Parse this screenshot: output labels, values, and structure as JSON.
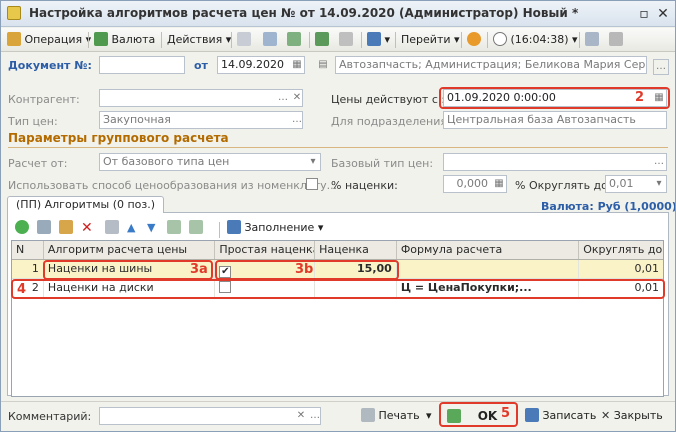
{
  "window": {
    "title": "Настройка алгоритмов расчета цен №  от 14.09.2020 (Администратор) Новый *"
  },
  "toolbar": {
    "operation": "Операция",
    "currency": "Валюта",
    "actions": "Действия",
    "goto": "Перейти",
    "time": "(16:04:38)"
  },
  "doc": {
    "number_label": "Документ №:",
    "number_value": "",
    "date_label": "от",
    "date_value": "14.09.2020",
    "org_value": "Автозапчасть; Администрация; Беликова Мария Сергеевна"
  },
  "form": {
    "counterparty_label": "Контрагент:",
    "counterparty_value": "",
    "price_type_label": "Тип цен:",
    "price_type_value": "Закупочная",
    "valid_from_label": "Цены действуют с :",
    "valid_from_value": "01.09.2020  0:00:00",
    "subdivision_label": "Для подразделения:",
    "subdivision_value": "Центральная база Автозапчасть"
  },
  "group": {
    "title": "Параметры группового расчета",
    "calc_from_label": "Расчет от:",
    "calc_from_value": "От базового типа цен",
    "base_price_label": "Базовый тип цен:",
    "base_price_value": "",
    "use_method_label": "Использовать способ ценообразования из номенклату...",
    "markup_label": "% наценки:",
    "markup_value": "0,000",
    "round_label": "% Округлять до:",
    "round_value": "0,01"
  },
  "tab": {
    "label": "(ПП) Алгоритмы (0 поз.)"
  },
  "currency_info": "Валюта: Руб (1,0000)",
  "fill_button": "Заполнение",
  "grid": {
    "headers": [
      "N",
      "Алгоритм расчета цены",
      "Простая наценка",
      "Наценка",
      "Формула расчета",
      "Округлять до"
    ],
    "rows": [
      {
        "n": "1",
        "algorithm": "Наценки на шины",
        "simple": "✔",
        "markup": "15,00",
        "formula": "",
        "round": "0,01"
      },
      {
        "n": "2",
        "algorithm": "Наценки на диски",
        "simple": "",
        "markup": "",
        "formula": "Ц = ЦенаПокупки;...",
        "round": "0,01"
      }
    ]
  },
  "bottom": {
    "comment_label": "Комментарий:",
    "comment_value": "",
    "print": "Печать",
    "ok": "OK",
    "save": "Записать",
    "close": "Закрыть"
  },
  "annotations": {
    "m2": "2",
    "m3a": "3a",
    "m3b": "3b",
    "m4": "4",
    "m5": "5"
  }
}
